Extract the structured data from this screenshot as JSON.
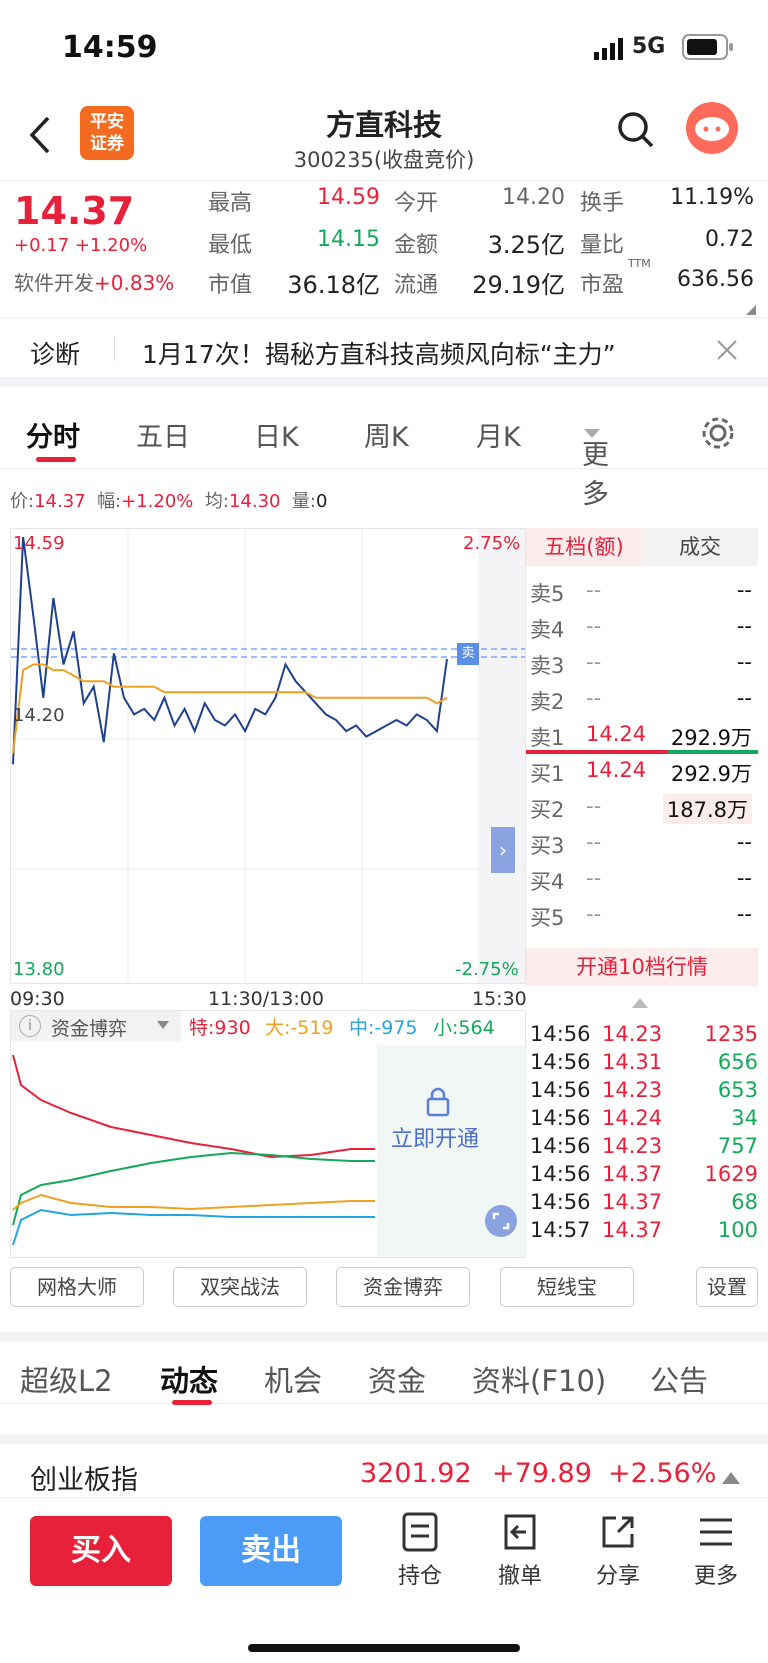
{
  "status": {
    "time": "14:59",
    "network": "5G"
  },
  "header": {
    "logo_line1": "平安",
    "logo_line2": "证券",
    "title": "方直科技",
    "subtitle": "300235(收盘竞价)"
  },
  "quote": {
    "price": "14.37",
    "change": "+0.17",
    "change_pct": "+1.20%",
    "sector_label": "软件开发",
    "sector_pct": "+0.83%",
    "high_label": "最高",
    "high": "14.59",
    "low_label": "最低",
    "low": "14.15",
    "mktcap_label": "市值",
    "mktcap": "36.18亿",
    "open_label": "今开",
    "open": "14.20",
    "amount_label": "金额",
    "amount": "3.25亿",
    "float_label": "流通",
    "float": "29.19亿",
    "turnover_label": "换手",
    "turnover": "11.19%",
    "volratio_label": "量比",
    "volratio": "0.72",
    "pe_label": "市盈",
    "pe_sup": "TTM",
    "pe": "636.56"
  },
  "diagnosis": {
    "label": "诊断",
    "text": "1月17次！揭秘方直科技高频风向标“主力”"
  },
  "chart_tabs": [
    "分时",
    "五日",
    "日K",
    "周K",
    "月K",
    "更多"
  ],
  "infobar": {
    "price_l": "价:",
    "price": "14.37",
    "amp_l": "幅:",
    "amp": "+1.20%",
    "avg_l": "均:",
    "avg": "14.30",
    "vol_l": "量:",
    "vol": "0"
  },
  "chart": {
    "ymax": "14.59",
    "ymid": "14.20",
    "ymin": "13.80",
    "pmax": "2.75%",
    "pmin": "-2.75%",
    "t0": "09:30",
    "t1": "11:30/13:00",
    "t2": "15:30",
    "sell_tag": "卖"
  },
  "chart_data": {
    "type": "line",
    "title": "",
    "xlabel": "",
    "ylabel": "",
    "ylim": [
      13.8,
      14.59
    ],
    "series": [
      {
        "name": "",
        "values": [
          14.18,
          14.59,
          14.45,
          14.3,
          14.48,
          14.36,
          14.42,
          14.29,
          14.32,
          14.22,
          14.38,
          14.3,
          14.27,
          14.28,
          14.26,
          14.3,
          14.25,
          14.28,
          14.24,
          14.29,
          14.26,
          14.25,
          14.27,
          14.24,
          14.28,
          14.27,
          14.3,
          14.36,
          14.33,
          14.31,
          14.29,
          14.27,
          14.26,
          14.24,
          14.25,
          14.23,
          14.24,
          14.25,
          14.26,
          14.25,
          14.27,
          14.26,
          14.24,
          14.37
        ]
      },
      {
        "name": "",
        "values": [
          14.2,
          14.35,
          14.36,
          14.36,
          14.35,
          14.35,
          14.34,
          14.33,
          14.33,
          14.33,
          14.32,
          14.32,
          14.32,
          14.32,
          14.32,
          14.31,
          14.31,
          14.31,
          14.31,
          14.31,
          14.31,
          14.31,
          14.31,
          14.31,
          14.31,
          14.31,
          14.31,
          14.31,
          14.31,
          14.31,
          14.3,
          14.3,
          14.3,
          14.3,
          14.3,
          14.3,
          14.3,
          14.3,
          14.3,
          14.3,
          14.3,
          14.3,
          14.29,
          14.3
        ]
      }
    ]
  },
  "book": {
    "tab1": "五档(额)",
    "tab2": "成交",
    "rows": [
      {
        "label": "卖5",
        "price": "--",
        "vol": "--"
      },
      {
        "label": "卖4",
        "price": "--",
        "vol": "--"
      },
      {
        "label": "卖3",
        "price": "--",
        "vol": "--"
      },
      {
        "label": "卖2",
        "price": "--",
        "vol": "--"
      },
      {
        "label": "卖1",
        "price": "14.24",
        "vol": "292.9万"
      },
      {
        "label": "买1",
        "price": "14.24",
        "vol": "292.9万"
      },
      {
        "label": "买2",
        "price": "--",
        "vol": "187.8万"
      },
      {
        "label": "买3",
        "price": "--",
        "vol": "--"
      },
      {
        "label": "买4",
        "price": "--",
        "vol": "--"
      },
      {
        "label": "买5",
        "price": "--",
        "vol": "--"
      }
    ],
    "open10": "开通10档行情"
  },
  "ticks": [
    {
      "time": "14:56",
      "price": "14.23",
      "vol": "1235"
    },
    {
      "time": "14:56",
      "price": "14.31",
      "vol": "656"
    },
    {
      "time": "14:56",
      "price": "14.23",
      "vol": "653"
    },
    {
      "time": "14:56",
      "price": "14.24",
      "vol": "34"
    },
    {
      "time": "14:56",
      "price": "14.23",
      "vol": "757"
    },
    {
      "time": "14:56",
      "price": "14.37",
      "vol": "1629"
    },
    {
      "time": "14:56",
      "price": "14.37",
      "vol": "68"
    },
    {
      "time": "14:57",
      "price": "14.37",
      "vol": "100"
    }
  ],
  "fund": {
    "label": "资金博弈",
    "te": "特:930",
    "da": "大:-519",
    "zhong": "中:-975",
    "xiao": "小:564",
    "unlock": "立即开通"
  },
  "tools": [
    "网格大师",
    "双突战法",
    "资金博弈",
    "短线宝",
    "设置"
  ],
  "bottom_tabs": [
    "超级L2",
    "动态",
    "机会",
    "资金",
    "资料(F10)",
    "公告"
  ],
  "index": {
    "name": "创业板指",
    "value": "3201.92",
    "change": "+79.89",
    "pct": "+2.56%"
  },
  "actions": {
    "buy": "买入",
    "sell": "卖出",
    "hold": "持仓",
    "cancel": "撤单",
    "share": "分享",
    "more": "更多"
  }
}
